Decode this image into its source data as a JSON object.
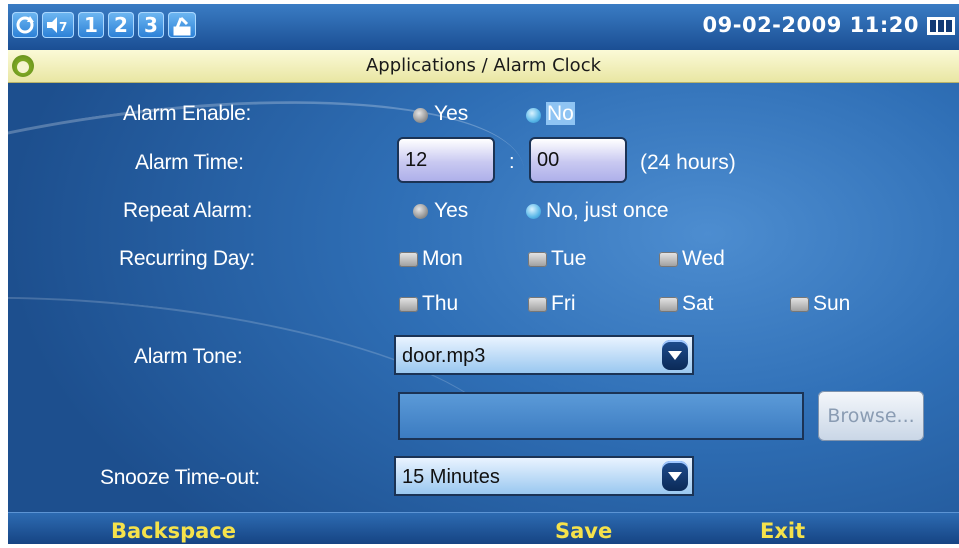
{
  "status_bar": {
    "icons": [
      "sync-icon",
      "volume-icon",
      "1",
      "2",
      "3",
      "sim-icon"
    ],
    "datetime": "09-02-2009 11:20"
  },
  "title_bar": {
    "title": "Applications / Alarm Clock",
    "app_icon": "alarm-clock-icon"
  },
  "form": {
    "alarm_enable": {
      "label": "Alarm Enable:",
      "options": [
        "Yes",
        "No"
      ],
      "selected": "No"
    },
    "alarm_time": {
      "label": "Alarm Time:",
      "hour": "12",
      "separator": ":",
      "minute": "00",
      "hint": "(24 hours)"
    },
    "repeat_alarm": {
      "label": "Repeat Alarm:",
      "options": [
        "Yes",
        "No, just once"
      ],
      "selected": "No, just once"
    },
    "recurring_day": {
      "label": "Recurring Day:",
      "days": [
        "Mon",
        "Tue",
        "Wed",
        "Thu",
        "Fri",
        "Sat",
        "Sun"
      ]
    },
    "alarm_tone": {
      "label": "Alarm Tone:",
      "value": "door.mp3",
      "path_value": "",
      "browse_label": "Browse..."
    },
    "snooze": {
      "label": "Snooze Time-out:",
      "value": "15 Minutes"
    }
  },
  "softkeys": {
    "left": "Backspace",
    "center": "Save",
    "right": "Exit"
  }
}
